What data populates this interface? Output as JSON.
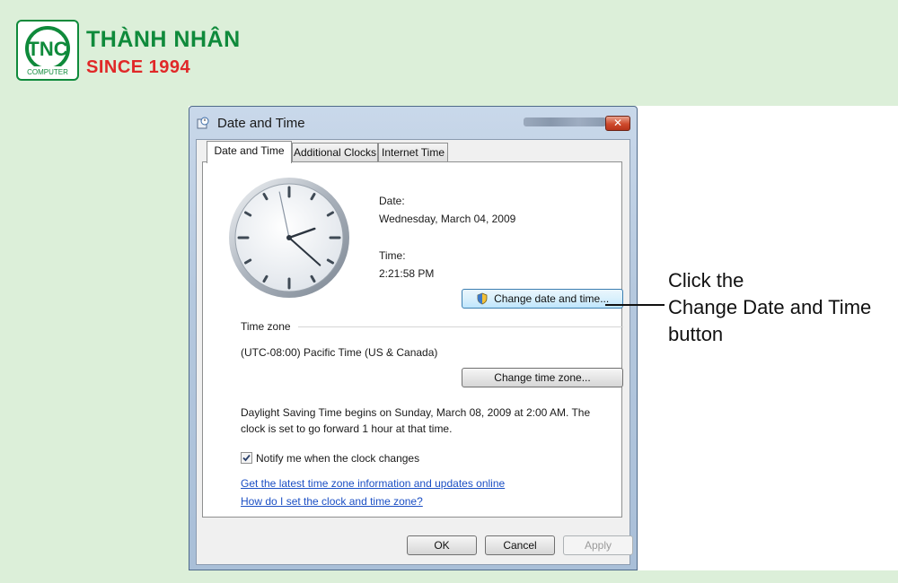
{
  "brand": {
    "logo_text": "TNC",
    "logo_sub": "COMPUTER",
    "name": "THÀNH NHÂN",
    "since": "SINCE 1994",
    "colors": {
      "green": "#0f8a3b",
      "red": "#e02828"
    }
  },
  "window": {
    "title": "Date and Time",
    "close_icon": "close-icon",
    "tabs": [
      {
        "label": "Date and Time",
        "active": true
      },
      {
        "label": "Additional Clocks",
        "active": false
      },
      {
        "label": "Internet Time",
        "active": false
      }
    ]
  },
  "datetime": {
    "date_label": "Date:",
    "date_value": "Wednesday, March 04, 2009",
    "time_label": "Time:",
    "time_value": "2:21:58 PM",
    "change_button": "Change date and time..."
  },
  "timezone": {
    "section_label": "Time zone",
    "value": "(UTC-08:00) Pacific Time (US & Canada)",
    "change_button": "Change time zone..."
  },
  "dst": {
    "line1": "Daylight Saving Time begins on Sunday, March 08, 2009 at 2:00 AM. The",
    "line2": "clock is set to go forward 1 hour at that time."
  },
  "notify": {
    "label": "Notify me when the clock changes",
    "checked": true
  },
  "links": {
    "updates": "Get the latest time zone information and updates online",
    "help": "How do I set the clock and time zone?"
  },
  "footer": {
    "ok": "OK",
    "cancel": "Cancel",
    "apply": "Apply"
  },
  "annotation": {
    "line1": "Click the",
    "line2": "Change Date and Time",
    "line3": "button"
  }
}
